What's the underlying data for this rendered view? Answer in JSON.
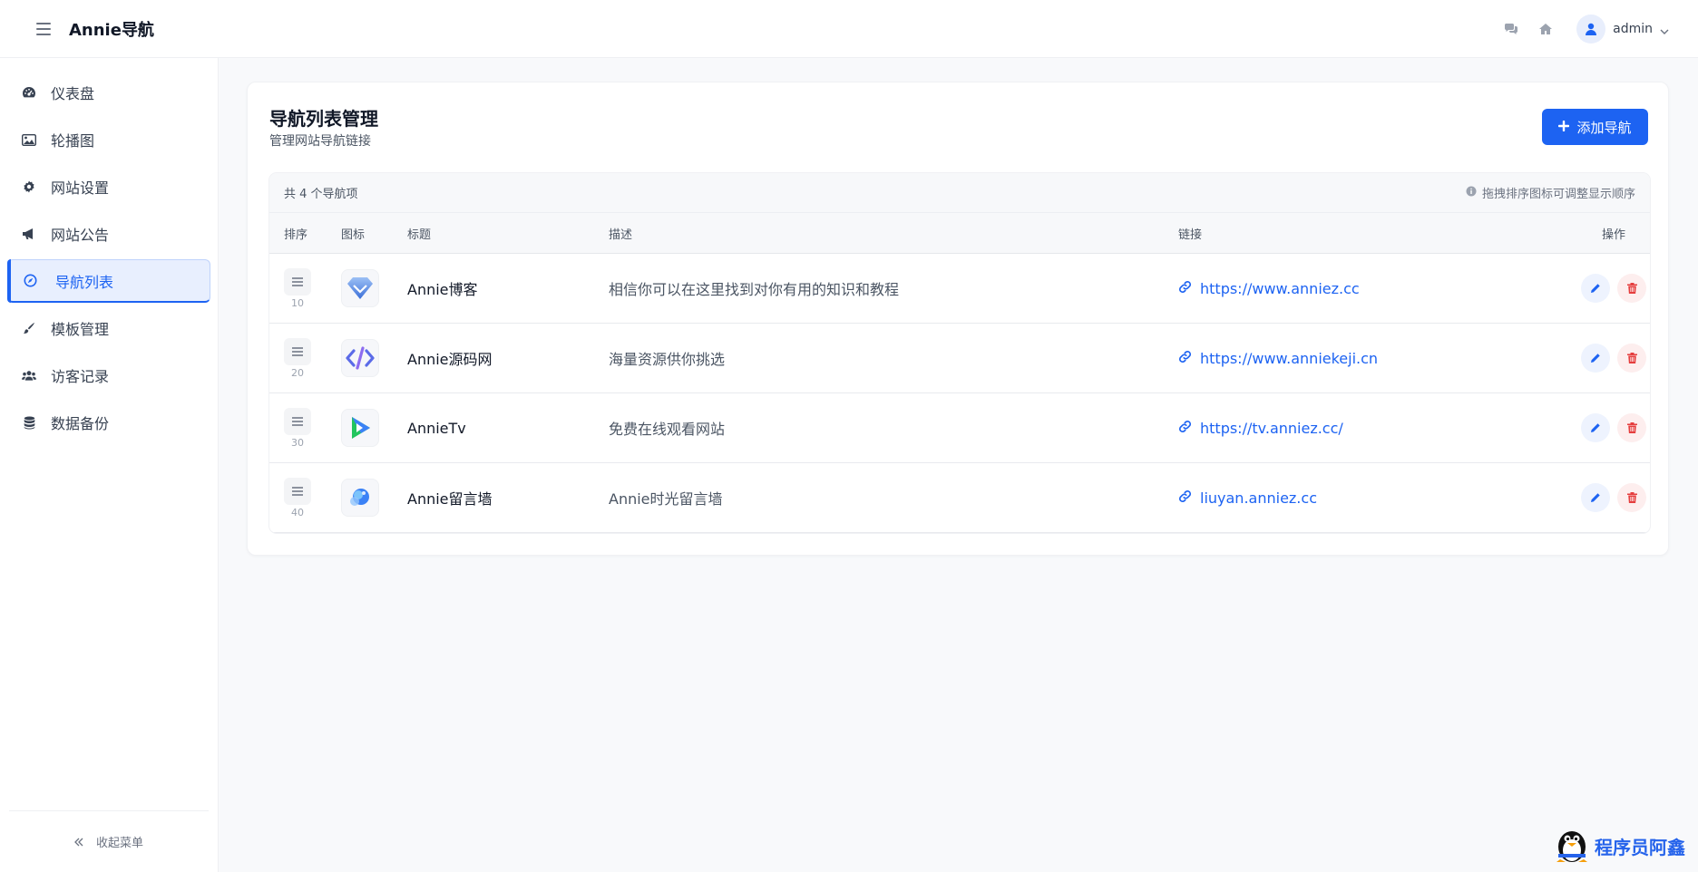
{
  "app": {
    "brand": "Annie导航"
  },
  "header": {
    "user_name": "admin"
  },
  "sidebar": {
    "items": [
      {
        "label": "仪表盘",
        "icon": "dashboard-icon"
      },
      {
        "label": "轮播图",
        "icon": "image-icon"
      },
      {
        "label": "网站设置",
        "icon": "gear-icon"
      },
      {
        "label": "网站公告",
        "icon": "megaphone-icon"
      },
      {
        "label": "导航列表",
        "icon": "compass-icon",
        "active": true
      },
      {
        "label": "模板管理",
        "icon": "brush-icon"
      },
      {
        "label": "访客记录",
        "icon": "users-icon"
      },
      {
        "label": "数据备份",
        "icon": "database-icon"
      }
    ],
    "collapse_label": "收起菜单"
  },
  "page": {
    "title": "导航列表管理",
    "subtitle": "管理网站导航链接",
    "add_button": "添加导航"
  },
  "table": {
    "count_text": "共 4 个导航项",
    "hint": "拖拽排序图标可调整显示顺序",
    "columns": [
      "排序",
      "图标",
      "标题",
      "描述",
      "链接",
      "操作"
    ],
    "rows": [
      {
        "order": "10",
        "title": "Annie博客",
        "desc": "相信你可以在这里找到对你有用的知识和教程",
        "link": "https://www.anniez.cc",
        "icon": "diamond-icon"
      },
      {
        "order": "20",
        "title": "Annie源码网",
        "desc": "海量资源供你挑选",
        "link": "https://www.anniekeji.cn",
        "icon": "code-icon"
      },
      {
        "order": "30",
        "title": "AnnieTv",
        "desc": "免费在线观看网站",
        "link": "https://tv.anniez.cc/",
        "icon": "play-icon"
      },
      {
        "order": "40",
        "title": "Annie留言墙",
        "desc": "Annie时光留言墙",
        "link": "liuyan.anniez.cc",
        "icon": "bubble-icon"
      }
    ]
  },
  "watermark": {
    "text": "程序员阿鑫"
  },
  "colors": {
    "primary": "#1d63f2",
    "danger": "#e53e3e",
    "sidebar_active_bg": "#e8effe"
  }
}
